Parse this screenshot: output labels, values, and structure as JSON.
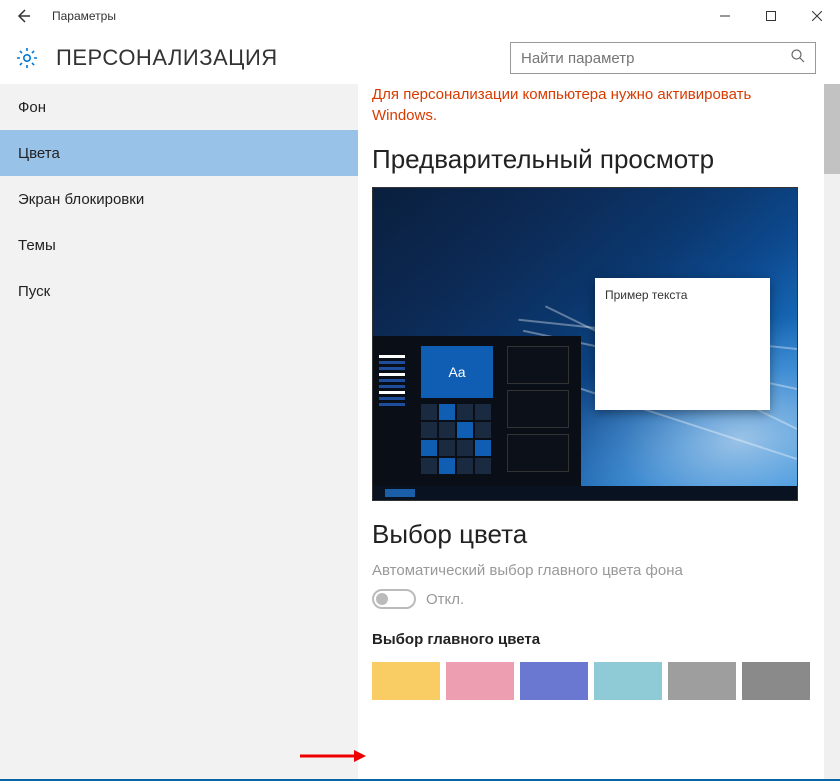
{
  "window": {
    "title": "Параметры"
  },
  "header": {
    "section": "ПЕРСОНАЛИЗАЦИЯ"
  },
  "search": {
    "placeholder": "Найти параметр"
  },
  "sidebar": {
    "items": [
      {
        "label": "Фон"
      },
      {
        "label": "Цвета"
      },
      {
        "label": "Экран блокировки"
      },
      {
        "label": "Темы"
      },
      {
        "label": "Пуск"
      }
    ],
    "active_index": 1
  },
  "main": {
    "warning": "Для персонализации компьютера нужно активировать Windows.",
    "preview_heading": "Предварительный просмотр",
    "preview": {
      "aa_label": "Aa",
      "sample_text": "Пример текста"
    },
    "color_heading": "Выбор цвета",
    "auto_label": "Автоматический выбор главного цвета фона",
    "toggle_state": "Откл.",
    "accent_heading": "Выбор главного цвета",
    "palette": [
      "#f9cc64",
      "#ee9eb1",
      "#6a78d1",
      "#8fcbd6",
      "#9e9e9e",
      "#8a8a8a"
    ]
  }
}
